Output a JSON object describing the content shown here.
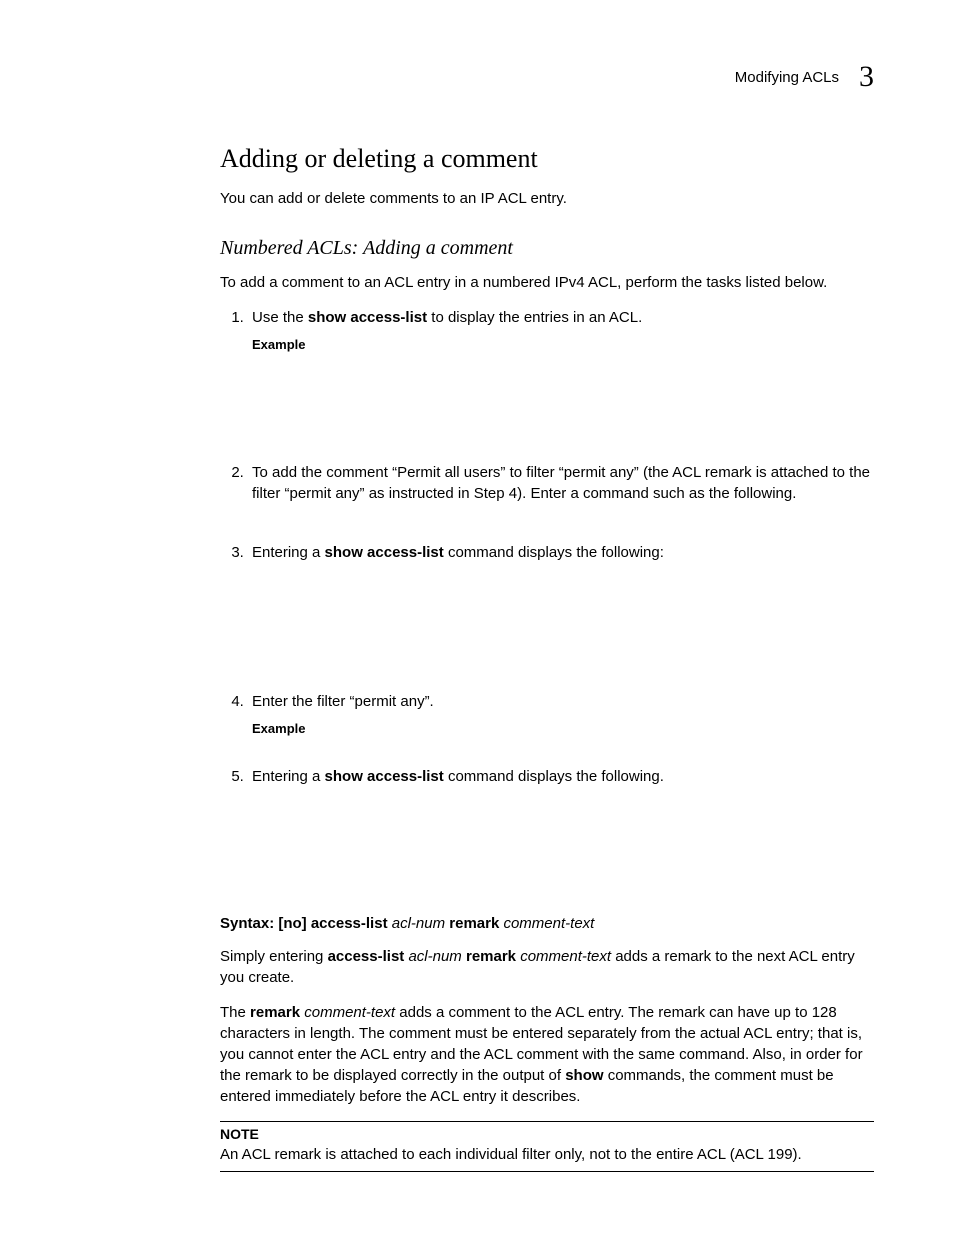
{
  "header": {
    "section": "Modifying ACLs",
    "chapter": "3"
  },
  "h1": "Adding or deleting a comment",
  "intro": "You can add or delete comments to an IP ACL entry.",
  "h2": "Numbered ACLs: Adding a comment",
  "subintro": "To add a comment to an ACL entry in a numbered IPv4 ACL, perform the tasks listed below.",
  "steps": {
    "s1_a": "Use the ",
    "s1_bold": "show access-list",
    "s1_b": " to display the entries in an ACL.",
    "example": "Example",
    "s2": "To add the comment “Permit all users” to filter “permit any” (the ACL remark is attached to the filter “permit any” as instructed in Step 4). Enter a command such as the following.",
    "s3_a": "Entering a ",
    "s3_bold": "show access-list",
    "s3_b": " command displays the following:",
    "s4": "Enter the filter “permit any”.",
    "s5_a": "Entering a ",
    "s5_bold": "show access-list",
    "s5_b": " command displays the following."
  },
  "syntax": {
    "label": "Syntax:  ",
    "p1": "[no] access-list ",
    "i1": "acl-num",
    "p2": "  remark ",
    "i2": "comment-text"
  },
  "para1": {
    "a": "Simply entering ",
    "b1": "access-list ",
    "i1": "acl-num",
    "b2": " remark ",
    "i2": "comment-text",
    "c": " adds a remark to the next ACL entry you create."
  },
  "para2": {
    "a": "The ",
    "b1": "remark ",
    "i1": "comment-text",
    "b": " adds a comment to the ACL entry. The remark can have up to 128 characters in length. The comment must be entered separately from the actual ACL entry; that is, you cannot enter the ACL entry and the ACL comment with the same command. Also, in order for the remark to be displayed correctly in the output of ",
    "b2": "show",
    "c": " commands, the comment must be entered immediately before the ACL entry it describes."
  },
  "note": {
    "title": "NOTE",
    "body": "An ACL remark is attached to each individual filter only, not to the entire ACL (ACL 199)."
  }
}
